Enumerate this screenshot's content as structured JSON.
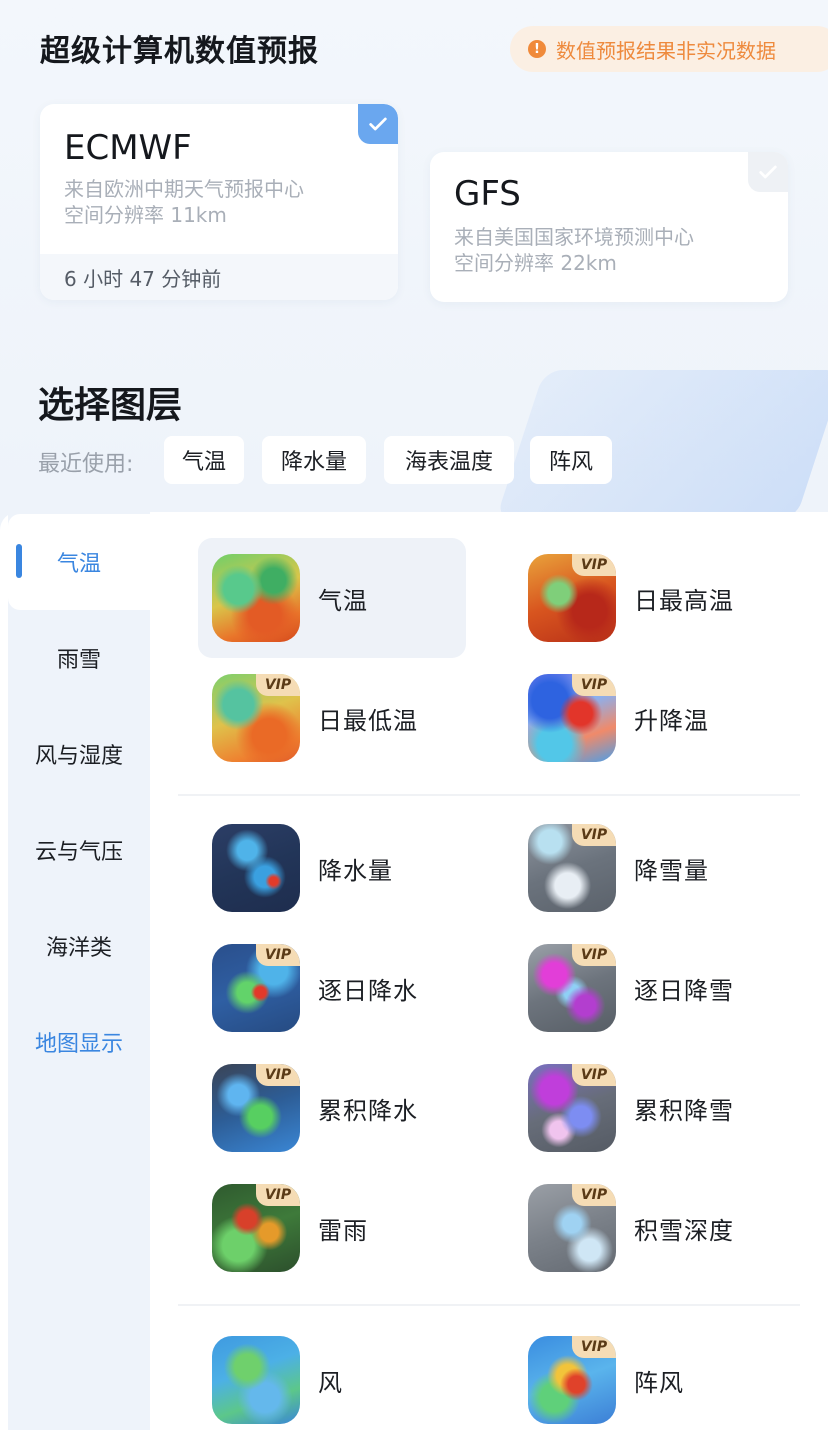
{
  "header": {
    "title": "超级计算机数值预报",
    "notice": "数值预报结果非实况数据",
    "notice_icon": "info-icon"
  },
  "models": {
    "ecmwf": {
      "name": "ECMWF",
      "source": "来自欧洲中期天气预报中心",
      "resolution": "空间分辨率 11km",
      "updated": "6 小时 47 分钟前",
      "selected": true
    },
    "gfs": {
      "name": "GFS",
      "source": "来自美国国家环境预测中心",
      "resolution": "空间分辨率 22km",
      "selected": false
    }
  },
  "layers": {
    "title": "选择图层",
    "recent_label": "最近使用:",
    "recent": [
      "气温",
      "降水量",
      "海表温度",
      "阵风"
    ]
  },
  "categories": {
    "items": [
      "气温",
      "雨雪",
      "风与湿度",
      "云与气压",
      "海洋类",
      "地图显示"
    ],
    "active": "气温"
  },
  "vip_label": "VIP",
  "layer_items": [
    {
      "label": "气温",
      "vip": false,
      "selected": true
    },
    {
      "label": "日最高温",
      "vip": true
    },
    {
      "label": "日最低温",
      "vip": true
    },
    {
      "label": "升降温",
      "vip": true
    },
    {
      "label": "降水量",
      "vip": false
    },
    {
      "label": "降雪量",
      "vip": true
    },
    {
      "label": "逐日降水",
      "vip": true
    },
    {
      "label": "逐日降雪",
      "vip": true
    },
    {
      "label": "累积降水",
      "vip": true
    },
    {
      "label": "累积降雪",
      "vip": true
    },
    {
      "label": "雷雨",
      "vip": true
    },
    {
      "label": "积雪深度",
      "vip": true
    },
    {
      "label": "风",
      "vip": false
    },
    {
      "label": "阵风",
      "vip": true
    }
  ],
  "colors": {
    "accent": "#3a86e0",
    "notice_bg": "#fbefe3",
    "notice_text": "#ee8a3d",
    "vip_bg": "#f5dcb5"
  }
}
